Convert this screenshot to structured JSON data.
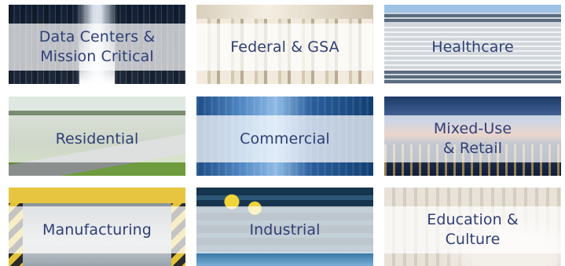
{
  "tiles": [
    {
      "label": "Data Centers &\nMission Critical",
      "image": "data-centers-image"
    },
    {
      "label": "Federal & GSA",
      "image": "federal-image"
    },
    {
      "label": "Healthcare",
      "image": "healthcare-image"
    },
    {
      "label": "Residential",
      "image": "residential-image"
    },
    {
      "label": "Commercial",
      "image": "commercial-image"
    },
    {
      "label": "Mixed-Use\n& Retail",
      "image": "mixed-use-image"
    },
    {
      "label": "Manufacturing",
      "image": "manufacturing-image"
    },
    {
      "label": "Industrial",
      "image": "industrial-image"
    },
    {
      "label": "Education &\nCulture",
      "image": "education-image"
    }
  ],
  "colors": {
    "label_text": "#2f3f76",
    "band": "rgba(255,255,255,0.72)"
  }
}
